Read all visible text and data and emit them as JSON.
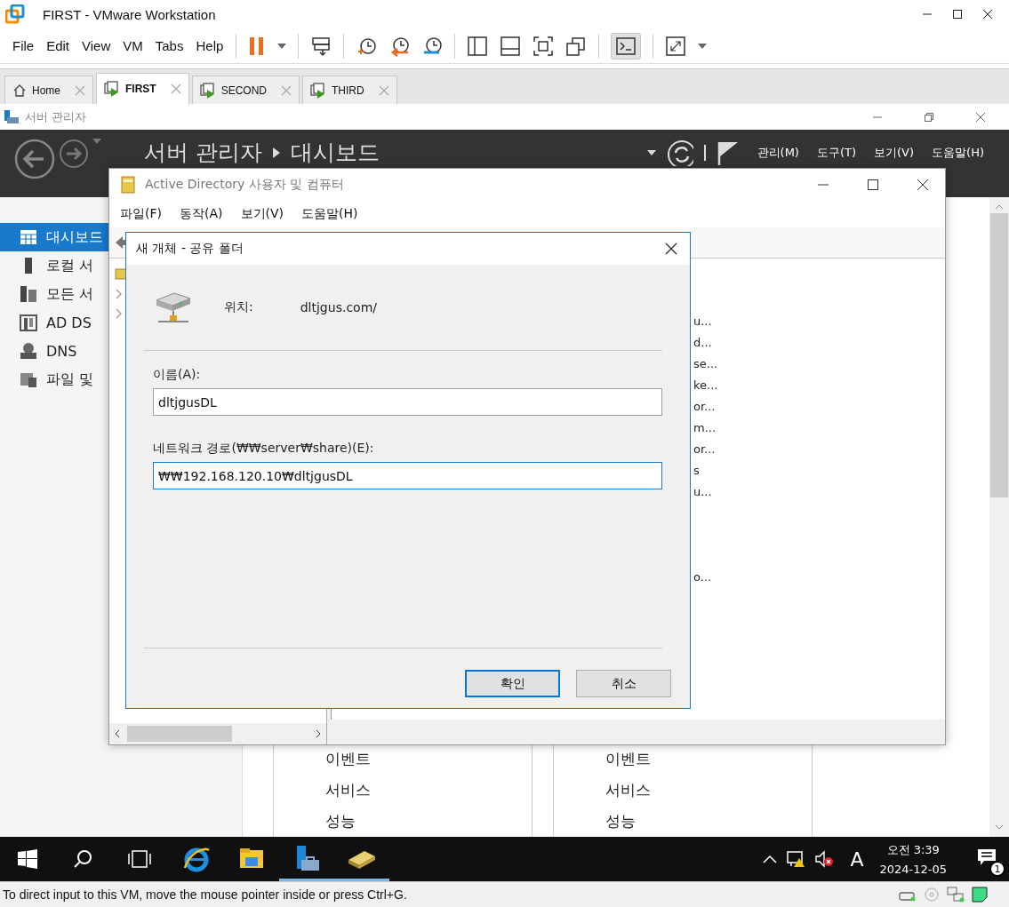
{
  "window": {
    "title": "FIRST - VMware Workstation"
  },
  "menu": [
    "File",
    "Edit",
    "View",
    "VM",
    "Tabs",
    "Help"
  ],
  "toolbar": {
    "console_view_active": true
  },
  "tabs": [
    {
      "label": "Home",
      "kind": "home",
      "selected": false
    },
    {
      "label": "FIRST",
      "kind": "vm",
      "selected": true
    },
    {
      "label": "SECOND",
      "kind": "vm",
      "selected": false
    },
    {
      "label": "THIRD",
      "kind": "vm",
      "selected": false
    }
  ],
  "server_manager": {
    "title": "서버 관리자",
    "breadcrumb": [
      "서버 관리자",
      "대시보드"
    ],
    "menu": [
      "관리(M)",
      "도구(T)",
      "보기(V)",
      "도움말(H)"
    ],
    "sidebar": [
      {
        "label": "대시보드",
        "kind": "dashboard",
        "selected": true
      },
      {
        "label": "로컬 서",
        "kind": "server",
        "selected": false
      },
      {
        "label": "모든 서",
        "kind": "servers",
        "selected": false
      },
      {
        "label": "AD DS",
        "kind": "adds",
        "selected": false
      },
      {
        "label": "DNS",
        "kind": "dns",
        "selected": false
      },
      {
        "label": "파일 및",
        "kind": "files",
        "selected": false
      }
    ],
    "tiles": [
      [
        "이벤트",
        "서비스",
        "성능"
      ],
      [
        "이벤트",
        "서비스",
        "성능"
      ]
    ]
  },
  "aduc": {
    "title": "Active Directory 사용자 및 컴퓨터",
    "menu": [
      "파일(F)",
      "동작(A)",
      "보기(V)",
      "도움말(H)"
    ],
    "list": [
      {
        "text": "u...",
        "kind": "row"
      },
      {
        "text": "d...",
        "kind": "row"
      },
      {
        "text": "se...",
        "kind": "row"
      },
      {
        "text": "ke...",
        "kind": "row"
      },
      {
        "text": "or...",
        "kind": "row"
      },
      {
        "text": "m...",
        "kind": "row"
      },
      {
        "text": "or...",
        "kind": "row"
      },
      {
        "text": "s",
        "kind": "row"
      },
      {
        "text": "u...",
        "kind": "row"
      },
      {
        "text": "o...",
        "kind": "after_gap"
      }
    ]
  },
  "dialog": {
    "title": "새 개체 - 공유 폴더",
    "location_label": "위치:",
    "location": "dltjgus.com/",
    "name_label": "이름(A):",
    "name_value": "dltjgusDL",
    "path_label": "네트워크 경로(₩₩server₩share)(E):",
    "path_value": "₩₩192.168.120.10₩dltjgusDL",
    "buttons": [
      {
        "label": "확인",
        "default": true
      },
      {
        "label": "취소",
        "default": false
      }
    ]
  },
  "taskbar": {
    "apps": [
      {
        "kind": "ie",
        "running": false
      },
      {
        "kind": "explorer",
        "running": false
      },
      {
        "kind": "server-manager",
        "running": true
      },
      {
        "kind": "aduc",
        "running": true
      }
    ],
    "input_mode": "A",
    "time": "오전 3:39",
    "date": "2024-12-05",
    "notifications": "1"
  },
  "status_bar": "To direct input to this VM, move the mouse pointer inside or press Ctrl+G."
}
